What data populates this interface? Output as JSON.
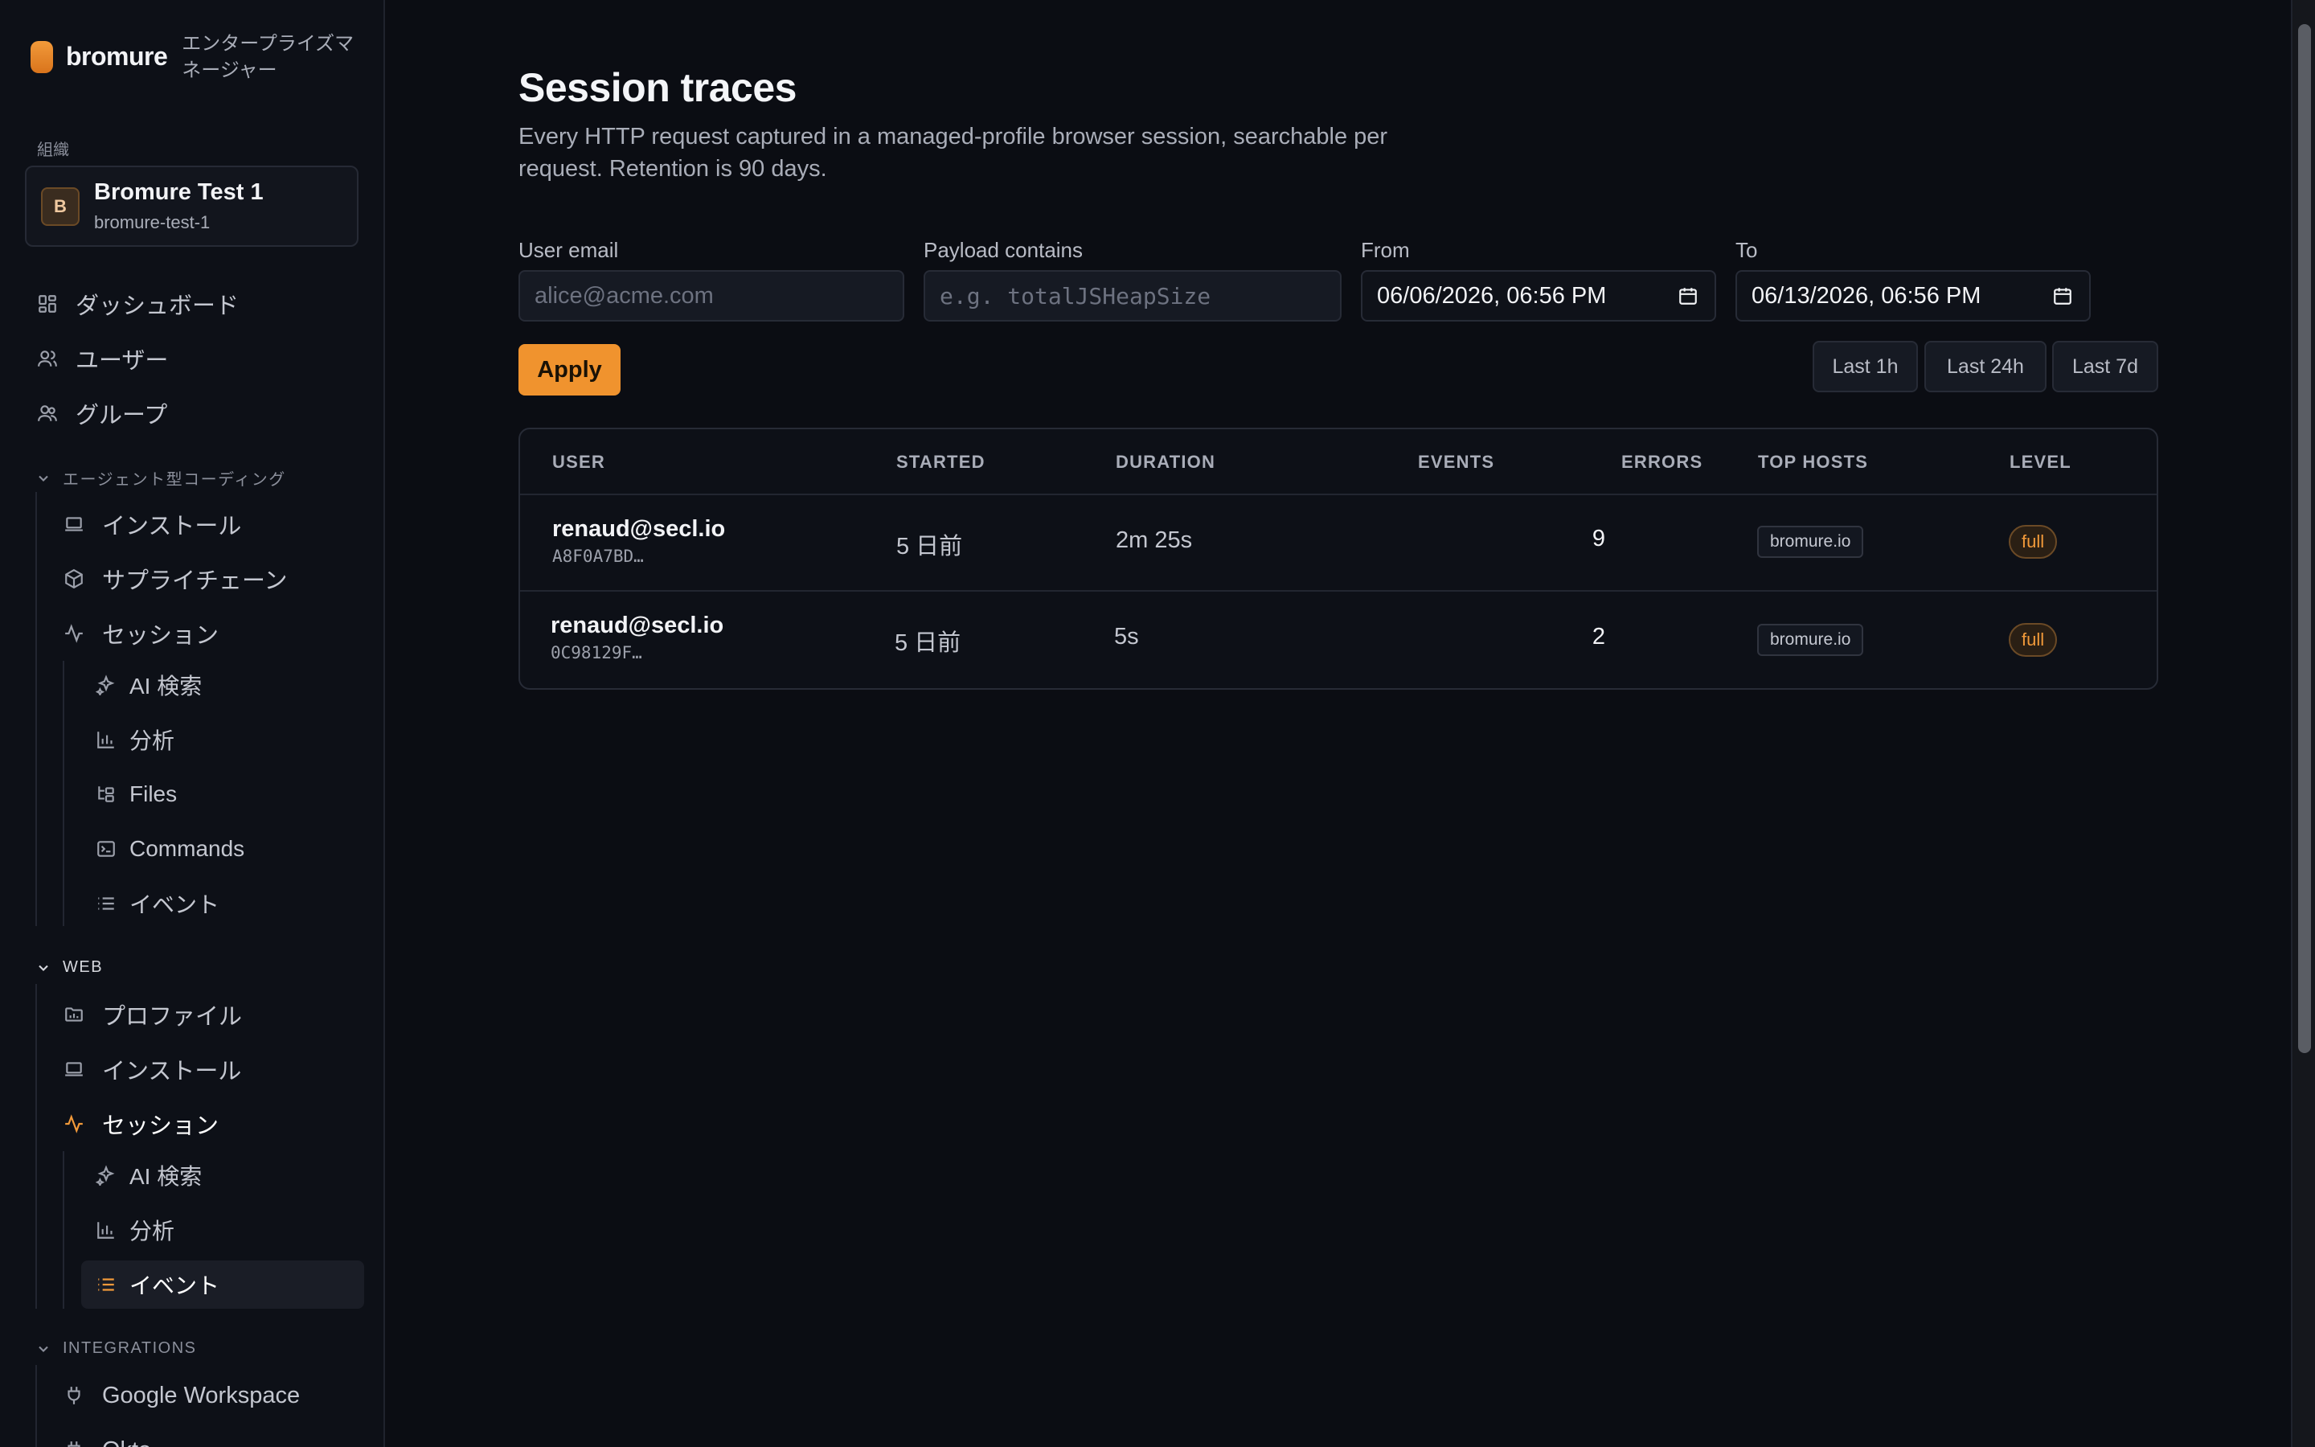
{
  "brand": {
    "name": "bromure",
    "subtitle": "エンタープライズマネージャー"
  },
  "org": {
    "label": "組織",
    "initial": "B",
    "name": "Bromure Test 1",
    "slug": "bromure-test-1"
  },
  "nav": {
    "dashboard": "ダッシュボード",
    "users": "ユーザー",
    "groups": "グループ",
    "agentic_section": "エージェント型コーディング",
    "agentic": {
      "install": "インストール",
      "supply_chain": "サプライチェーン",
      "sessions": "セッション",
      "ai_search": "AI 検索",
      "analytics": "分析",
      "files": "Files",
      "commands": "Commands",
      "events": "イベント"
    },
    "web_section": "WEB",
    "web": {
      "profiles": "プロファイル",
      "install": "インストール",
      "sessions": "セッション",
      "ai_search": "AI 検索",
      "analytics": "分析",
      "events": "イベント"
    },
    "integrations_section": "INTEGRATIONS",
    "integrations": {
      "google": "Google Workspace",
      "next": "Okta"
    }
  },
  "page": {
    "title": "Session traces",
    "subtitle": "Every HTTP request captured in a managed-profile browser session, searchable per request. Retention is 90 days."
  },
  "filters": {
    "user_email_label": "User email",
    "user_email_placeholder": "alice@acme.com",
    "payload_label": "Payload contains",
    "payload_placeholder": "e.g. totalJSHeapSize",
    "from_label": "From",
    "from_value": "06/06/2026, 06:56 PM",
    "to_label": "To",
    "to_value": "06/13/2026, 06:56 PM",
    "apply": "Apply",
    "ranges": [
      "Last 1h",
      "Last 24h",
      "Last 7d"
    ]
  },
  "table": {
    "headers": {
      "user": "USER",
      "started": "STARTED",
      "duration": "DURATION",
      "events": "EVENTS",
      "errors": "ERRORS",
      "top_hosts": "TOP HOSTS",
      "level": "LEVEL"
    },
    "rows": [
      {
        "user": "renaud@secl.io",
        "id": "A8F0A7BD…",
        "started": "5 日前",
        "duration": "2m 25s",
        "events": "9",
        "errors": "—",
        "host": "bromure.io",
        "level": "full"
      },
      {
        "user": "renaud@secl.io",
        "id": "0C98129F…",
        "started": "5 日前",
        "duration": "5s",
        "events": "2",
        "errors": "—",
        "host": "bromure.io",
        "level": "full"
      }
    ]
  },
  "colors": {
    "accent": "#f0932e",
    "background": "#0b0d13",
    "sidebar": "#0d1017"
  }
}
